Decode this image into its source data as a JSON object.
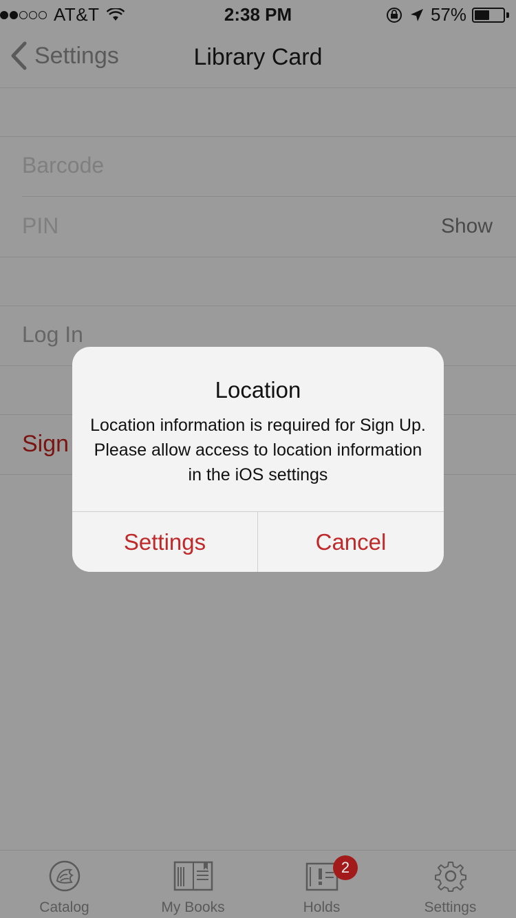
{
  "status_bar": {
    "signal_dots_filled": 2,
    "signal_dots_total": 5,
    "carrier": "AT&T",
    "time": "2:38 PM",
    "battery_percent": "57%",
    "battery_level": 0.57
  },
  "nav": {
    "back_label": "Settings",
    "title": "Library Card"
  },
  "form": {
    "barcode_placeholder": "Barcode",
    "pin_placeholder": "PIN",
    "show_label": "Show",
    "login_label": "Log In",
    "signup_label": "Sign"
  },
  "alert": {
    "title": "Location",
    "message": "Location information is required for Sign Up. Please allow access to location information in the iOS settings",
    "buttons": [
      "Settings",
      "Cancel"
    ]
  },
  "tabs": [
    {
      "label": "Catalog",
      "icon": "lion-icon"
    },
    {
      "label": "My Books",
      "icon": "book-icon"
    },
    {
      "label": "Holds",
      "icon": "holds-icon",
      "badge": "2"
    },
    {
      "label": "Settings",
      "icon": "gear-icon"
    }
  ],
  "colors": {
    "accent": "#c0292a",
    "dimmed_background": "#9b9b9b"
  }
}
